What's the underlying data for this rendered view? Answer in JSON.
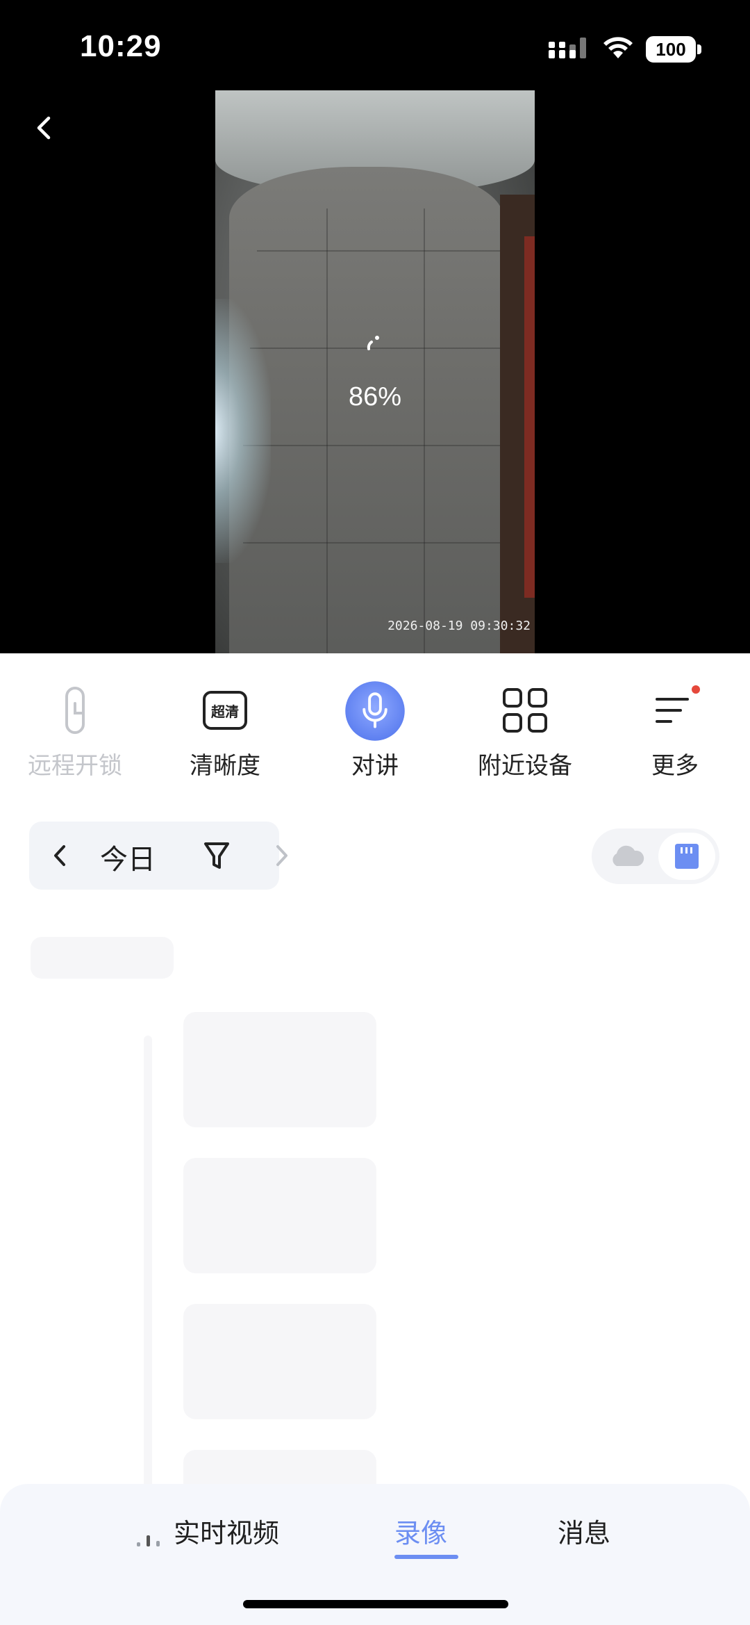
{
  "status_bar": {
    "time": "10:29",
    "battery": "100"
  },
  "player": {
    "loading_percent_text": "86%",
    "timestamp": "2026-08-19 09:30:32"
  },
  "toolbar": {
    "items": [
      {
        "label": "远程开锁",
        "icon": "lock-icon",
        "enabled": false
      },
      {
        "label": "清晰度",
        "icon": "quality-icon",
        "badge": "超清",
        "enabled": true
      },
      {
        "label": "对讲",
        "icon": "microphone-icon",
        "enabled": true
      },
      {
        "label": "附近设备",
        "icon": "grid-icon",
        "enabled": true
      },
      {
        "label": "更多",
        "icon": "menu-icon",
        "has_dot": true,
        "enabled": true
      }
    ]
  },
  "date_filter": {
    "label": "今日"
  },
  "source_toggle": {
    "options": [
      "cloud-icon",
      "sd-card-icon"
    ],
    "selected": "sd-card-icon"
  },
  "tabs": {
    "items": [
      {
        "label": "实时视频"
      },
      {
        "label": "录像",
        "active": true
      },
      {
        "label": "消息"
      }
    ]
  },
  "colors": {
    "accent": "#6c8ef2",
    "dot": "#e5483b",
    "disabled": "#c4c6cb"
  }
}
